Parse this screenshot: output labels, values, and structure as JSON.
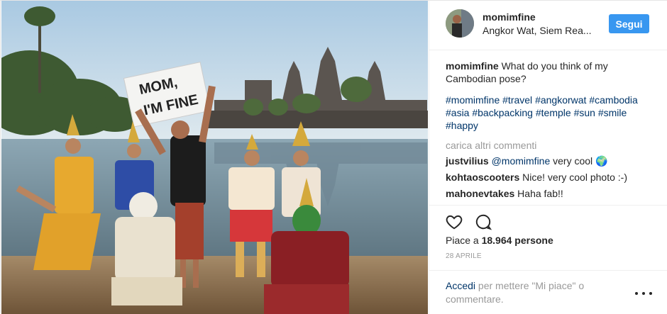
{
  "post": {
    "username": "momimfine",
    "location": "Angkor Wat, Siem Rea...",
    "follow_label": "Segui",
    "sign_text": [
      "MOM,",
      "I'M FINE"
    ]
  },
  "caption": {
    "username": "momimfine",
    "text": "What do you think of my Cambodian pose?",
    "hashtags": [
      "#momimfine",
      "#travel",
      "#angkorwat",
      "#cambodia",
      "#asia",
      "#backpacking",
      "#temple",
      "#sun",
      "#smile",
      "#happy"
    ]
  },
  "load_more_label": "carica altri commenti",
  "comments": [
    {
      "username": "justvilius",
      "mention": "@momimfine",
      "text": "very cool 🌍"
    },
    {
      "username": "kohtaoscooters",
      "text": "Nice! very cool photo :-)"
    },
    {
      "username": "mahonevtakes",
      "text": "Haha fab!!"
    }
  ],
  "actions": {
    "like_icon": "heart-outline-icon",
    "comment_icon": "speech-bubble-icon"
  },
  "likes": {
    "prefix": "Piace a",
    "count": "18.964 persone"
  },
  "date": "28 APRILE",
  "add_comment": {
    "login_link": "Accedi",
    "rest": "per mettere \"Mi piace\" o commentare."
  },
  "colors": {
    "accent": "#3897f0",
    "link": "#003569",
    "muted": "#999999"
  }
}
